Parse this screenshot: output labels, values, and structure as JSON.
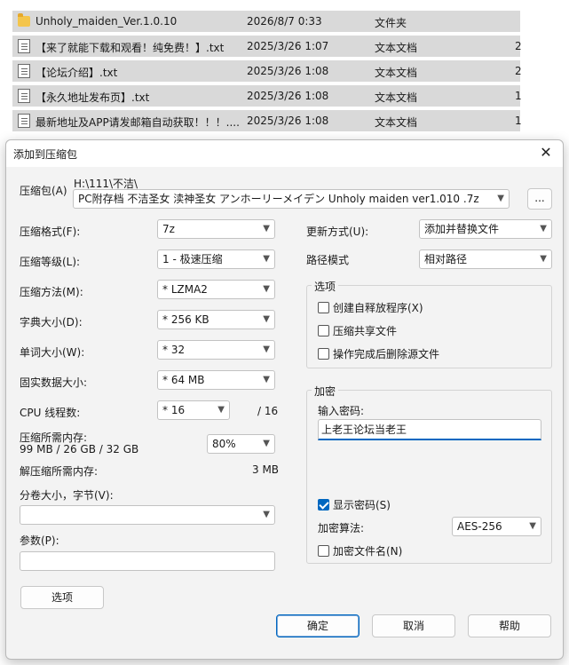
{
  "file_list": [
    {
      "icon": "folder-icon",
      "name": "Unholy_maiden_Ver.1.0.10",
      "date": "2026/8/7 0:33",
      "type": "文件夹",
      "size": ""
    },
    {
      "icon": "text-file-icon",
      "name": "【来了就能下载和观看！纯免费！】.txt",
      "date": "2025/3/26 1:07",
      "type": "文本文档",
      "size": "2"
    },
    {
      "icon": "text-file-icon",
      "name": "【论坛介绍】.txt",
      "date": "2025/3/26 1:08",
      "type": "文本文档",
      "size": "2"
    },
    {
      "icon": "text-file-icon",
      "name": "【永久地址发布页】.txt",
      "date": "2025/3/26 1:08",
      "type": "文本文档",
      "size": "1"
    },
    {
      "icon": "text-file-icon",
      "name": "最新地址及APP请发邮箱自动获取！！！....",
      "date": "2025/3/26 1:08",
      "type": "文本文档",
      "size": "1"
    }
  ],
  "dialog": {
    "title": "添加到压缩包",
    "close": "✕",
    "archive_label": "压缩包(A)",
    "archive_path": "H:\\111\\不洁\\",
    "archive_name": "PC附存档 不洁圣女 渎神圣女 アンホーリーメイデン Unholy maiden ver1.010 .7z",
    "browse_label": "...",
    "format_label": "压缩格式(F):",
    "format_value": "7z",
    "level_label": "压缩等级(L):",
    "level_value": "1 - 极速压缩",
    "method_label": "压缩方法(M):",
    "method_value": "*  LZMA2",
    "dict_label": "字典大小(D):",
    "dict_value": "*  256 KB",
    "word_label": "单词大小(W):",
    "word_value": "*  32",
    "solid_label": "固实数据大小:",
    "solid_value": "*  64 MB",
    "cpu_label": "CPU 线程数:",
    "cpu_value": "*  16",
    "cpu_total": "/ 16",
    "mem_label": "压缩所需内存:",
    "mem_detail": "99 MB / 26 GB / 32 GB",
    "mem_percent": "80%",
    "decomp_label": "解压缩所需内存:",
    "decomp_value": "3 MB",
    "volume_label": "分卷大小，字节(V):",
    "volume_value": "",
    "params_label": "参数(P):",
    "params_value": "",
    "options_button": "选项",
    "update_label": "更新方式(U):",
    "update_value": "添加并替换文件",
    "path_label": "路径模式",
    "path_value": "相对路径",
    "options_group": "选项",
    "opt_sfx": "创建自释放程序(X)",
    "opt_shared": "压缩共享文件",
    "opt_delete": "操作完成后删除源文件",
    "encrypt_group": "加密",
    "password_label": "输入密码:",
    "password_value": "上老王论坛当老王",
    "show_password": "显示密码(S)",
    "method_enc_label": "加密算法:",
    "method_enc_value": "AES-256",
    "encrypt_names": "加密文件名(N)",
    "ok": "确定",
    "cancel": "取消",
    "help": "帮助"
  }
}
